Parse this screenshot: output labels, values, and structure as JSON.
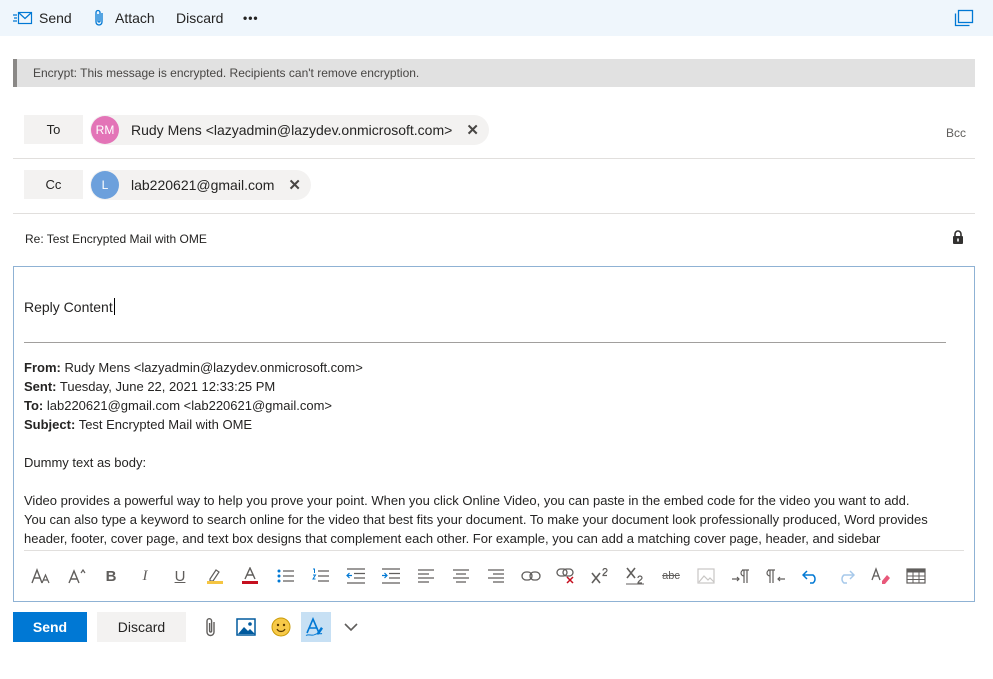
{
  "toolbar": {
    "send_label": "Send",
    "attach_label": "Attach",
    "discard_label": "Discard",
    "more_label": "•••"
  },
  "banner": {
    "text": "Encrypt: This message is encrypted. Recipients can't remove encryption."
  },
  "recipients": {
    "to_label": "To",
    "cc_label": "Cc",
    "bcc_label": "Bcc",
    "to": [
      {
        "initials": "RM",
        "display": "Rudy Mens <lazyadmin@lazydev.onmicrosoft.com>",
        "color": "#e374b7"
      }
    ],
    "cc": [
      {
        "initials": "L",
        "display": "lab220621@gmail.com",
        "color": "#6ca0dc"
      }
    ],
    "remove_glyph": "✕"
  },
  "subject": {
    "text": "Re: Test Encrypted Mail with OME"
  },
  "body": {
    "reply": "Reply Content",
    "from_label": "From:",
    "from_value": "Rudy Mens <lazyadmin@lazydev.onmicrosoft.com>",
    "sent_label": "Sent:",
    "sent_value": "Tuesday, June 22, 2021 12:33:25 PM",
    "to_label": "To:",
    "to_value": "lab220621@gmail.com <lab220621@gmail.com>",
    "subject_label": "Subject:",
    "subject_value": "Test Encrypted Mail with OME",
    "intro": "Dummy text as body:",
    "para1": "Video provides a powerful way to help you prove your point. When you click Online Video, you can paste in the embed code for the video you want to add.",
    "para2": "You can also type a keyword to search online for the video that best fits your document. To make your document look professionally produced, Word provides",
    "para3": "header, footer, cover page, and text box designs that complement each other. For example, you can add a matching cover page, header, and sidebar"
  },
  "format_toolbar": {
    "bold": "B",
    "italic": "I",
    "underline": "U",
    "strike": "abc"
  },
  "bottom": {
    "send_label": "Send",
    "discard_label": "Discard"
  },
  "colors": {
    "accent": "#0078d4",
    "command_bar_bg": "#eff6fc",
    "banner_bg": "#e1e1e1",
    "highlight": "#f5c542",
    "font_red": "#c50f1f"
  }
}
